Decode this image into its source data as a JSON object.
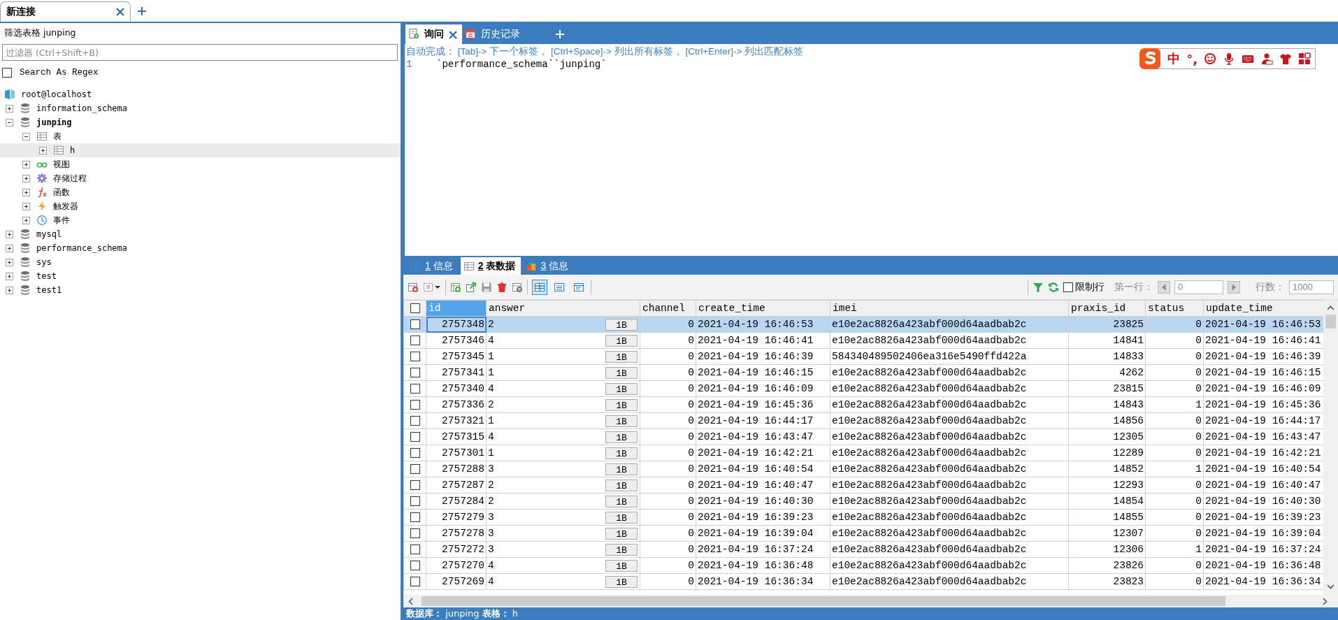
{
  "connection_tabs": [
    {
      "label": "新连接"
    }
  ],
  "sidebar": {
    "filter_title": "筛选表格 junping",
    "filter": {
      "placeholder": "过滤器 (Ctrl+Shift+B)"
    },
    "regex": {
      "label": "Search As Regex",
      "checked": false
    },
    "tree": [
      {
        "kind": "connection",
        "label": "root@localhost",
        "selected": false,
        "current": false,
        "children": [
          {
            "kind": "database",
            "label": "information_schema",
            "selected": false,
            "current": false,
            "expanded": false
          },
          {
            "kind": "database",
            "label": "junping",
            "selected": false,
            "current": true,
            "expanded": true,
            "children": [
              {
                "kind": "tables",
                "label": "表",
                "selected": false,
                "current": false,
                "expanded": true,
                "children": [
                  {
                    "kind": "table",
                    "label": "h",
                    "selected": true,
                    "current": false,
                    "expanded": false
                  }
                ]
              },
              {
                "kind": "views",
                "label": "视图",
                "selected": false,
                "current": false,
                "expanded": false
              },
              {
                "kind": "procedures",
                "label": "存储过程",
                "selected": false,
                "current": false,
                "expanded": false
              },
              {
                "kind": "functions",
                "label": "函数",
                "selected": false,
                "current": false,
                "expanded": false
              },
              {
                "kind": "triggers",
                "label": "触发器",
                "selected": false,
                "current": false,
                "expanded": false
              },
              {
                "kind": "events",
                "label": "事件",
                "selected": false,
                "current": false,
                "expanded": false
              }
            ]
          },
          {
            "kind": "database",
            "label": "mysql",
            "selected": false,
            "current": false,
            "expanded": false
          },
          {
            "kind": "database",
            "label": "performance_schema",
            "selected": false,
            "current": false,
            "expanded": false
          },
          {
            "kind": "database",
            "label": "sys",
            "selected": false,
            "current": false,
            "expanded": false
          },
          {
            "kind": "database",
            "label": "test",
            "selected": false,
            "current": false,
            "expanded": false
          },
          {
            "kind": "database",
            "label": "test1",
            "selected": false,
            "current": false,
            "expanded": false
          }
        ]
      }
    ]
  },
  "query_tabs": [
    {
      "kind": "query",
      "label": "询问",
      "selected": true
    },
    {
      "kind": "history",
      "label": "历史记录",
      "selected": false
    }
  ],
  "editor": {
    "hint": "自动完成： [Tab]-> 下一个标签， [Ctrl+Space]-> 列出所有标签， [Ctrl+Enter]-> 列出匹配标签",
    "lines": [
      {
        "number": "1",
        "code": "`performance_schema``junping`"
      }
    ]
  },
  "ime": {
    "mode": "中",
    "punctuation": "°,"
  },
  "result_tabs": [
    {
      "kind": "info",
      "number": "1",
      "label": "信息",
      "selected": false
    },
    {
      "kind": "grid",
      "number": "2",
      "label": "表数据",
      "selected": true
    },
    {
      "kind": "chart",
      "number": "3",
      "label": "信息",
      "selected": false
    }
  ],
  "toolbar": {
    "view_modes": [
      {
        "kind": "grid",
        "selected": true
      },
      {
        "kind": "form",
        "selected": false
      },
      {
        "kind": "text",
        "selected": false
      }
    ],
    "limit": {
      "label": "限制行",
      "checked": false
    },
    "first_row": {
      "label": "第一行：",
      "value": "0"
    },
    "row_count": {
      "label": "行数：",
      "value": "1000"
    }
  },
  "table": {
    "header_checked": false,
    "columns": [
      {
        "label": "id",
        "kind": "number",
        "selected": true
      },
      {
        "label": "answer",
        "kind": "blob",
        "selected": false
      },
      {
        "label": "channel",
        "kind": "number",
        "selected": false
      },
      {
        "label": "create_time",
        "kind": "text",
        "selected": false
      },
      {
        "label": "imei",
        "kind": "text",
        "selected": false
      },
      {
        "label": "praxis_id",
        "kind": "number",
        "selected": false
      },
      {
        "label": "status",
        "kind": "number",
        "selected": false
      },
      {
        "label": "update_time",
        "kind": "text",
        "selected": false
      }
    ],
    "rows": [
      {
        "selected": true,
        "checked": false,
        "blob": "1B",
        "cells": [
          "2757348",
          "2",
          "0",
          "2021-04-19 16:46:53",
          "e10e2ac8826a423abf000d64aadbab2c",
          "23825",
          "0",
          "2021-04-19 16:46:53"
        ]
      },
      {
        "selected": false,
        "checked": false,
        "blob": "1B",
        "cells": [
          "2757346",
          "4",
          "0",
          "2021-04-19 16:46:41",
          "e10e2ac8826a423abf000d64aadbab2c",
          "14841",
          "0",
          "2021-04-19 16:46:41"
        ]
      },
      {
        "selected": false,
        "checked": false,
        "blob": "1B",
        "cells": [
          "2757345",
          "1",
          "0",
          "2021-04-19 16:46:39",
          "584340489502406ea316e5490ffd422a",
          "14833",
          "0",
          "2021-04-19 16:46:39"
        ]
      },
      {
        "selected": false,
        "checked": false,
        "blob": "1B",
        "cells": [
          "2757341",
          "1",
          "0",
          "2021-04-19 16:46:15",
          "e10e2ac8826a423abf000d64aadbab2c",
          "4262",
          "0",
          "2021-04-19 16:46:15"
        ]
      },
      {
        "selected": false,
        "checked": false,
        "blob": "1B",
        "cells": [
          "2757340",
          "4",
          "0",
          "2021-04-19 16:46:09",
          "e10e2ac8826a423abf000d64aadbab2c",
          "23815",
          "0",
          "2021-04-19 16:46:09"
        ]
      },
      {
        "selected": false,
        "checked": false,
        "blob": "1B",
        "cells": [
          "2757336",
          "2",
          "0",
          "2021-04-19 16:45:36",
          "e10e2ac8826a423abf000d64aadbab2c",
          "14843",
          "1",
          "2021-04-19 16:45:36"
        ]
      },
      {
        "selected": false,
        "checked": false,
        "blob": "1B",
        "cells": [
          "2757321",
          "1",
          "0",
          "2021-04-19 16:44:17",
          "e10e2ac8826a423abf000d64aadbab2c",
          "14856",
          "0",
          "2021-04-19 16:44:17"
        ]
      },
      {
        "selected": false,
        "checked": false,
        "blob": "1B",
        "cells": [
          "2757315",
          "4",
          "0",
          "2021-04-19 16:43:47",
          "e10e2ac8826a423abf000d64aadbab2c",
          "12305",
          "0",
          "2021-04-19 16:43:47"
        ]
      },
      {
        "selected": false,
        "checked": false,
        "blob": "1B",
        "cells": [
          "2757301",
          "1",
          "0",
          "2021-04-19 16:42:21",
          "e10e2ac8826a423abf000d64aadbab2c",
          "12289",
          "0",
          "2021-04-19 16:42:21"
        ]
      },
      {
        "selected": false,
        "checked": false,
        "blob": "1B",
        "cells": [
          "2757288",
          "3",
          "0",
          "2021-04-19 16:40:54",
          "e10e2ac8826a423abf000d64aadbab2c",
          "14852",
          "1",
          "2021-04-19 16:40:54"
        ]
      },
      {
        "selected": false,
        "checked": false,
        "blob": "1B",
        "cells": [
          "2757287",
          "2",
          "0",
          "2021-04-19 16:40:47",
          "e10e2ac8826a423abf000d64aadbab2c",
          "12293",
          "0",
          "2021-04-19 16:40:47"
        ]
      },
      {
        "selected": false,
        "checked": false,
        "blob": "1B",
        "cells": [
          "2757284",
          "2",
          "0",
          "2021-04-19 16:40:30",
          "e10e2ac8826a423abf000d64aadbab2c",
          "14854",
          "0",
          "2021-04-19 16:40:30"
        ]
      },
      {
        "selected": false,
        "checked": false,
        "blob": "1B",
        "cells": [
          "2757279",
          "3",
          "0",
          "2021-04-19 16:39:23",
          "e10e2ac8826a423abf000d64aadbab2c",
          "14855",
          "0",
          "2021-04-19 16:39:23"
        ]
      },
      {
        "selected": false,
        "checked": false,
        "blob": "1B",
        "cells": [
          "2757278",
          "3",
          "0",
          "2021-04-19 16:39:04",
          "e10e2ac8826a423abf000d64aadbab2c",
          "12307",
          "0",
          "2021-04-19 16:39:04"
        ]
      },
      {
        "selected": false,
        "checked": false,
        "blob": "1B",
        "cells": [
          "2757272",
          "3",
          "0",
          "2021-04-19 16:37:24",
          "e10e2ac8826a423abf000d64aadbab2c",
          "12306",
          "1",
          "2021-04-19 16:37:24"
        ]
      },
      {
        "selected": false,
        "checked": false,
        "blob": "1B",
        "cells": [
          "2757270",
          "4",
          "0",
          "2021-04-19 16:36:48",
          "e10e2ac8826a423abf000d64aadbab2c",
          "23826",
          "0",
          "2021-04-19 16:36:48"
        ]
      },
      {
        "selected": false,
        "checked": false,
        "blob": "1B",
        "cells": [
          "2757269",
          "4",
          "0",
          "2021-04-19 16:36:34",
          "e10e2ac8826a423abf000d64aadbab2c",
          "23823",
          "0",
          "2021-04-19 16:36:34"
        ]
      }
    ]
  },
  "status_bar": "**数据库：** junping **表格：** h"
}
